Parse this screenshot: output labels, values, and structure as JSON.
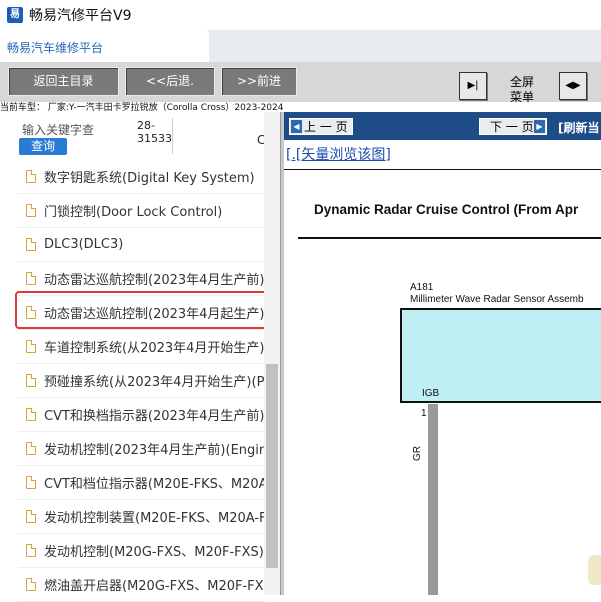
{
  "window": {
    "title": "畅易汽修平台V9",
    "icon": "app-icon"
  },
  "tab": {
    "label": "畅易汽车维修平台"
  },
  "toolbar": {
    "home_label": "返回主目录",
    "back_label": "<<后退.",
    "forward_label": ">>前进",
    "fullscreen_label": "全屏",
    "menu_label": "菜单"
  },
  "model_line": "当前车型： 厂家:Y-一汽丰田卡罗拉锐放（Corolla Cross）2023-2024",
  "search": {
    "placeholder": "输入关键字查",
    "button_label": "查询",
    "code": "28-31533",
    "c_text": "C"
  },
  "list": {
    "items": [
      {
        "label": "数字钥匙系统(Digital Key System)"
      },
      {
        "label": "门锁控制(Door Lock Control)"
      },
      {
        "label": "DLC3(DLC3)"
      },
      {
        "label": "动态雷达巡航控制(2023年4月生产前)("
      },
      {
        "label": "动态雷达巡航控制(2023年4月起生产)("
      },
      {
        "label": "车道控制系统(从2023年4月开始生产)("
      },
      {
        "label": "预碰撞系统(从2023年4月开始生产)(Pr"
      },
      {
        "label": "CVT和换档指示器(2023年4月生产前)("
      },
      {
        "label": "发动机控制(2023年4月生产前)(Engine"
      },
      {
        "label": "CVT和档位指示器(M20E-FKS、M20A"
      },
      {
        "label": "发动机控制装置(M20E-FKS、M20A-F"
      },
      {
        "label": "发动机控制(M20G-FXS、M20F-FXS)("
      },
      {
        "label": "燃油盖开启器(M20G-FXS、M20F-FX"
      }
    ],
    "selected_index": 4
  },
  "docbar": {
    "prev_label": "上 一 页",
    "next_label": "下 一 页",
    "refresh_label": "[刷新当"
  },
  "document": {
    "vector_link": "[.[矢量浏览该图]",
    "diagram_title": "Dynamic Radar Cruise Control (From Apr",
    "connector_code": "A181",
    "component_label": "Millimeter Wave Radar Sensor Assemb",
    "ground_label": "IGB",
    "pin_number": "1",
    "wire_color": "GR"
  },
  "colors": {
    "accent": "#2a7bd3",
    "docbar": "#1d4c87",
    "highlight": "#e03838",
    "sensor_fill": "#bfeff3"
  }
}
